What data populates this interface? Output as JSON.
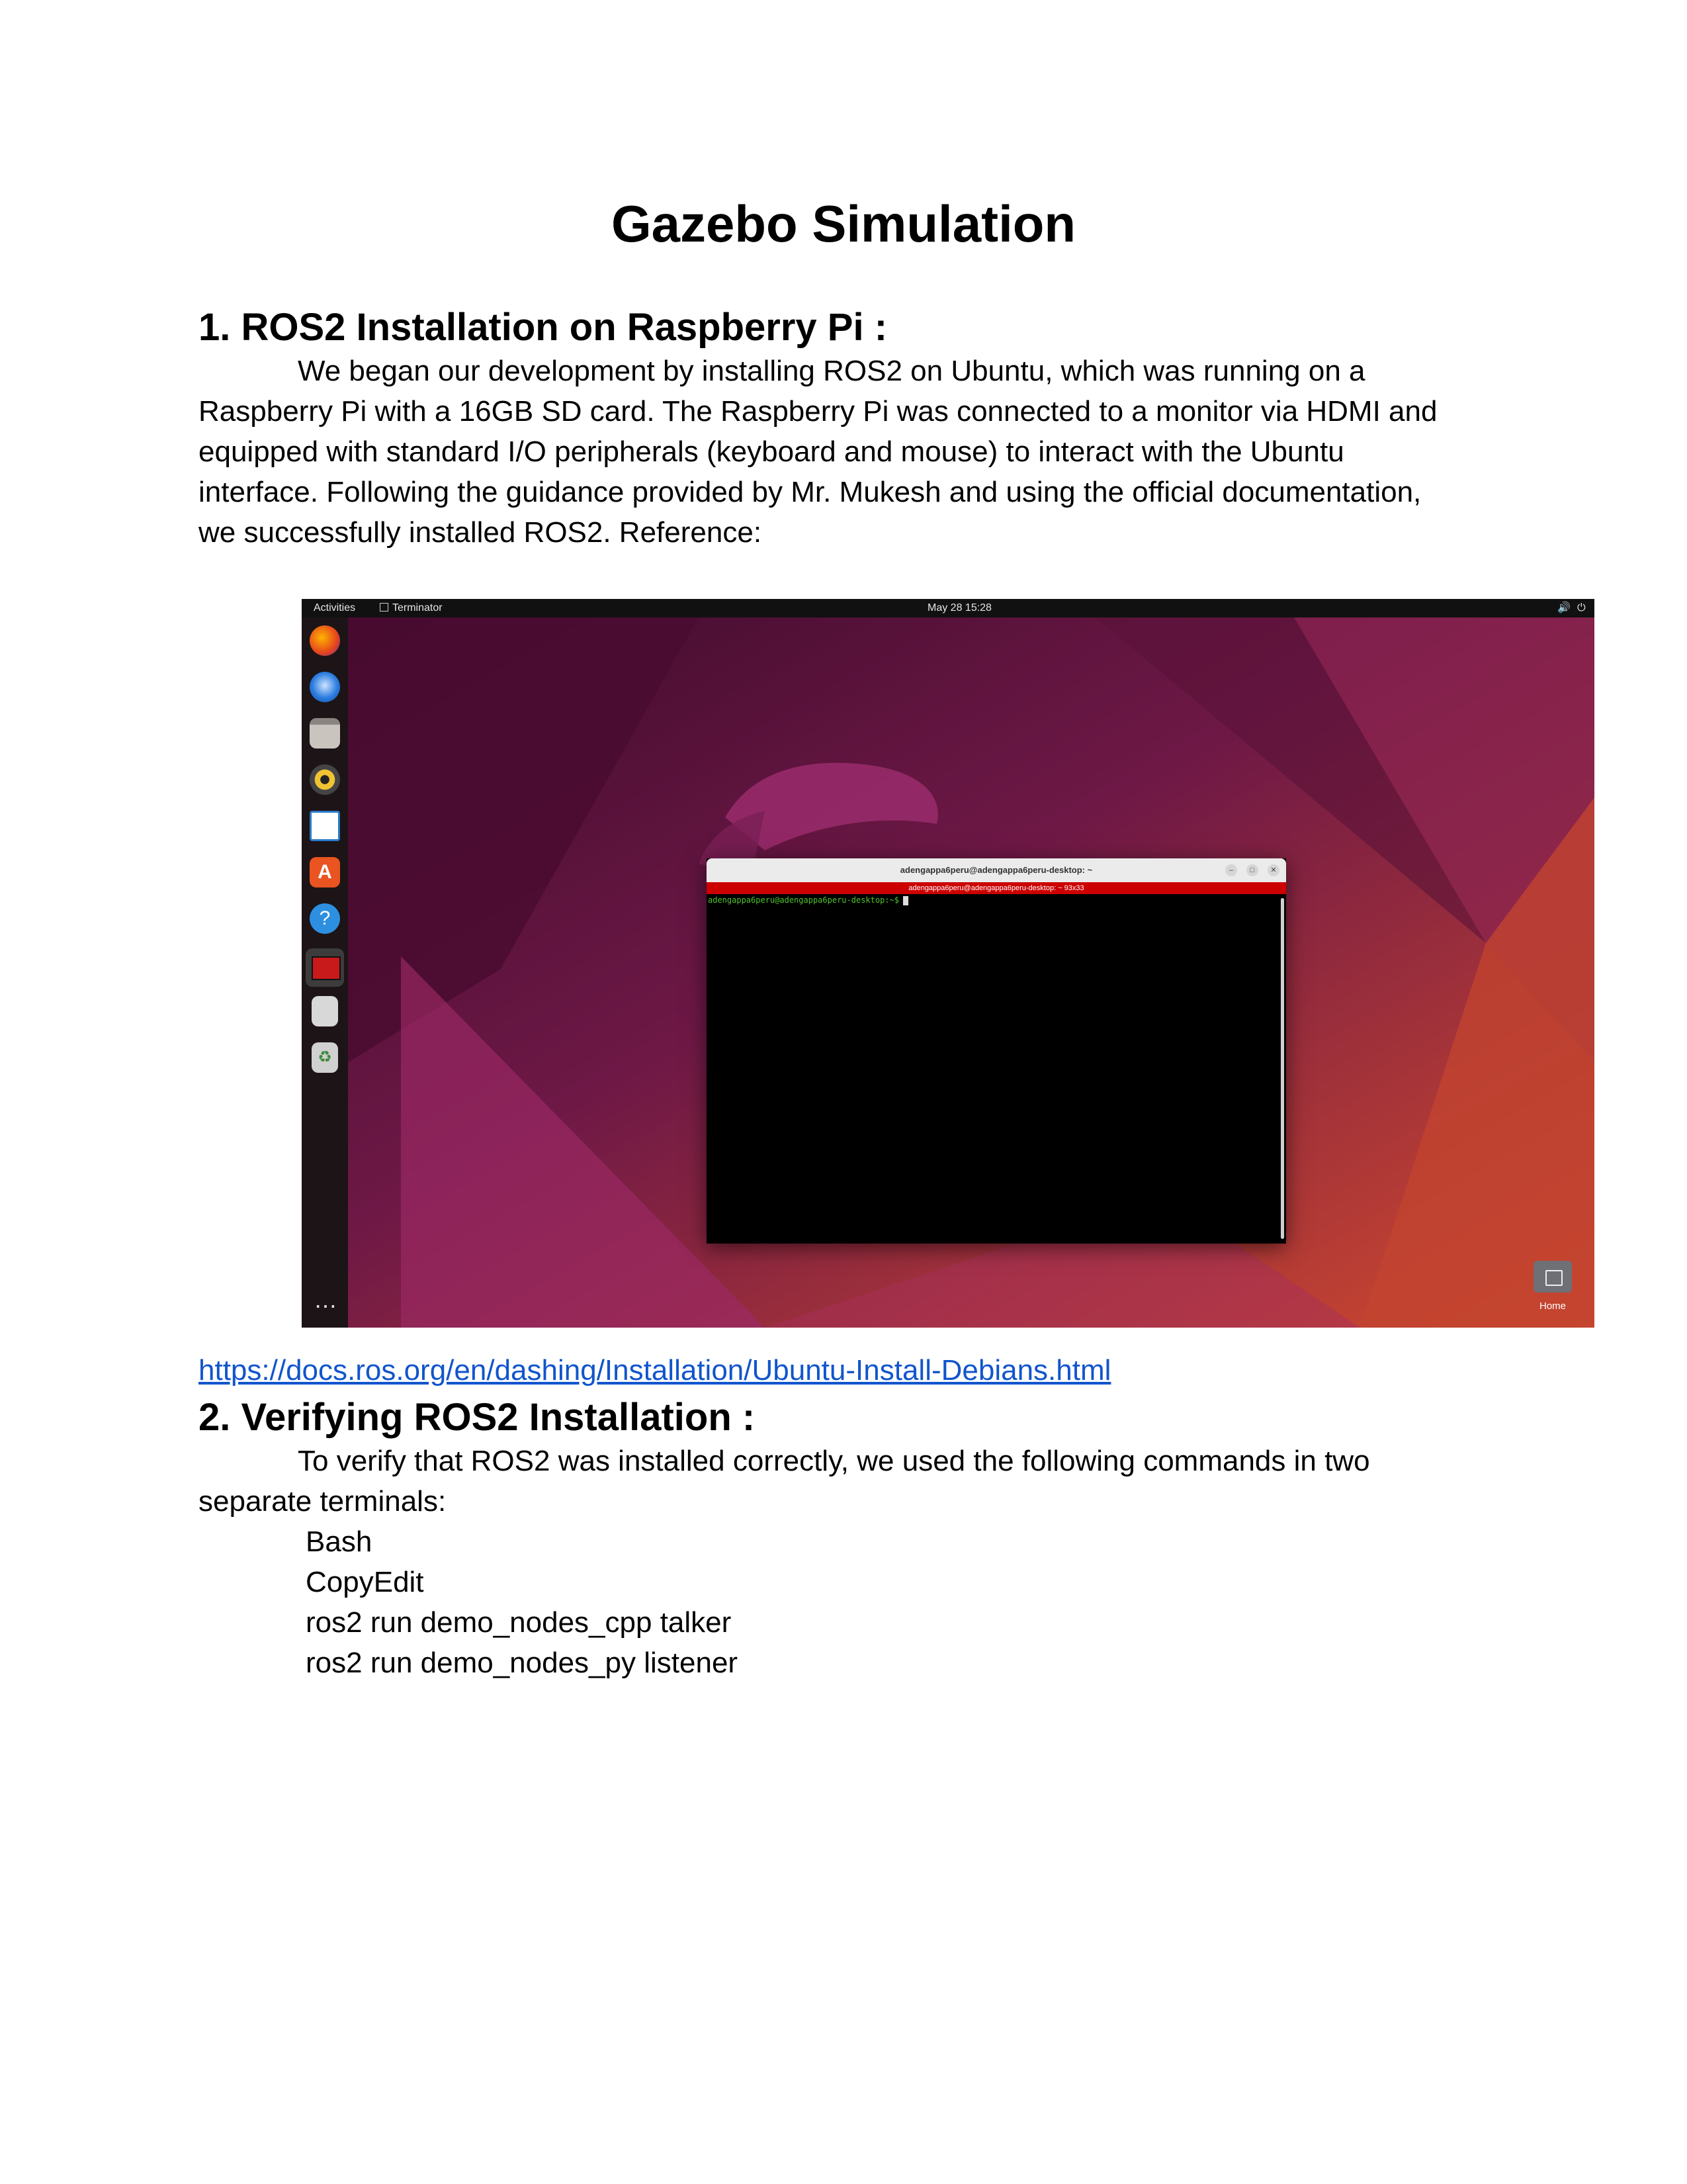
{
  "document": {
    "title": "Gazebo Simulation",
    "section1": {
      "heading": "1. ROS2 Installation on Raspberry Pi :",
      "lines": [
        "We began our development by installing ROS2 on Ubuntu, which was running on a",
        "Raspberry Pi with a 16GB SD card. The Raspberry Pi was connected to a monitor via HDMI and",
        "equipped with standard I/O peripherals (keyboard and mouse) to interact with the Ubuntu",
        "interface. Following the guidance provided by Mr. Mukesh and using the official documentation,",
        "we successfully installed ROS2. Reference:"
      ],
      "link": "https://docs.ros.org/en/dashing/Installation/Ubuntu-Install-Debians.html"
    },
    "section2": {
      "heading": "2. Verifying ROS2 Installation :",
      "lines": [
        "To verify that ROS2 was installed correctly, we used the following commands in two",
        "separate terminals:"
      ],
      "code": [
        "Bash",
        "CopyEdit",
        "ros2 run demo_nodes_cpp talker",
        "ros2 run demo_nodes_py listener"
      ]
    }
  },
  "screenshot": {
    "topbar": {
      "activities": "Activities",
      "app_name": "Terminator",
      "clock": "May 28  15:28"
    },
    "dock_icons": [
      "firefox-icon",
      "thunderbird-icon",
      "files-icon",
      "rhythmbox-icon",
      "libreoffice-writer-icon",
      "software-center-icon",
      "help-icon",
      "terminator-icon",
      "text-editor-icon",
      "trash-icon"
    ],
    "terminal": {
      "window_title": "adengappa6peru@adengappa6peru-desktop: ~",
      "tab_title": "adengappa6peru@adengappa6peru-desktop: ~ 93x33",
      "prompt": "adengappa6peru@adengappa6peru-desktop:~$"
    },
    "desktop_home_label": "Home",
    "colors": {
      "terminal_tab": "#cc0000",
      "prompt": "#4ec42c"
    }
  }
}
